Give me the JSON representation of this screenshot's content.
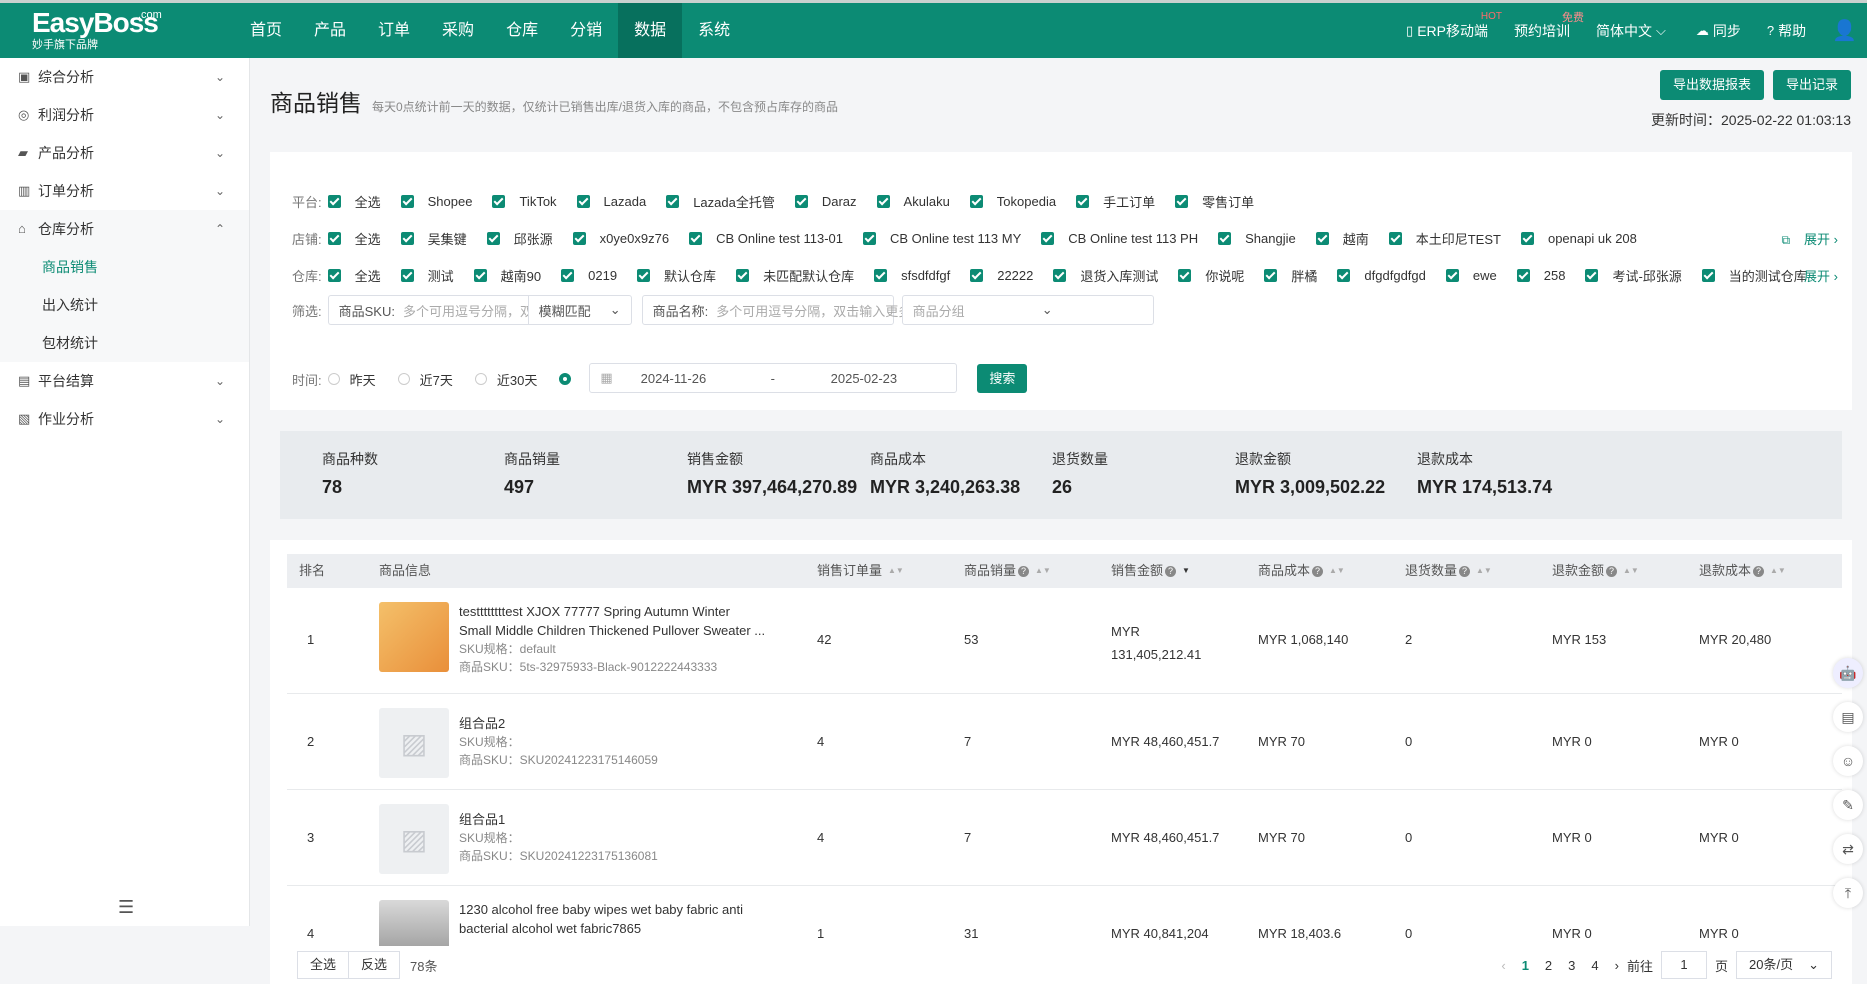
{
  "brand": {
    "logo": "EasyBoss",
    "com": ".com",
    "sub": "妙手旗下品牌"
  },
  "nav": [
    "首页",
    "产品",
    "订单",
    "采购",
    "仓库",
    "分销",
    "数据",
    "系统"
  ],
  "right_nav": {
    "erp": "ERP移动端",
    "hot": "HOT",
    "train": "预约培训",
    "free": "免费",
    "lang": "简体中文",
    "sync": "同步",
    "help": "帮助"
  },
  "sidebar": {
    "groups": [
      "综合分析",
      "利润分析",
      "产品分析",
      "订单分析",
      "仓库分析",
      "平台结算",
      "作业分析"
    ],
    "sub": [
      "商品销售",
      "出入统计",
      "包材统计"
    ]
  },
  "page": {
    "title": "商品销售",
    "desc": "每天0点统计前一天的数据，仅统计已销售出库/退货入库的商品，不包含预占库存的商品",
    "export_report": "导出数据报表",
    "export_log": "导出记录",
    "update_label": "更新时间：",
    "update_time": "2025-02-22 01:03:13"
  },
  "filters": {
    "platform_label": "平台:",
    "platforms": [
      "全选",
      "Shopee",
      "TikTok",
      "Lazada",
      "Lazada全托管",
      "Daraz",
      "Akulaku",
      "Tokopedia",
      "手工订单",
      "零售订单"
    ],
    "shop_label": "店铺:",
    "shops": [
      "全选",
      "吴集键",
      "邱张源",
      "x0ye0x9z76",
      "CB Online test 113-01",
      "CB Online test 113 MY",
      "CB Online test 113 PH",
      "Shangjie",
      "越南",
      "本土印尼TEST",
      "openapi uk 208"
    ],
    "warehouse_label": "仓库:",
    "warehouses": [
      "全选",
      "测试",
      "越南90",
      "0219",
      "默认仓库",
      "未匹配默认仓库",
      "sfsdfdfgf",
      "22222",
      "退货入库测试",
      "你说呢",
      "胖橘",
      "dfgdfgdfgd",
      "ewe",
      "258",
      "考试-邱张源",
      "当的测试仓库"
    ],
    "expand": "展开",
    "filter_label": "筛选:",
    "sku_label": "商品SKU:",
    "sku_placeholder": "多个可用逗号分隔，双击",
    "match": "模糊匹配",
    "name_label": "商品名称:",
    "name_placeholder": "多个可用逗号分隔，双击输入更多",
    "group_placeholder": "商品分组",
    "time_label": "时间:",
    "times": [
      "昨天",
      "近7天",
      "近30天"
    ],
    "date_start": "2024-11-26",
    "date_sep": "-",
    "date_end": "2025-02-23",
    "search": "搜索"
  },
  "stats": [
    {
      "label": "商品种数",
      "value": "78"
    },
    {
      "label": "商品销量",
      "value": "497"
    },
    {
      "label": "销售金额",
      "value": "MYR 397,464,270.89"
    },
    {
      "label": "商品成本",
      "value": "MYR 3,240,263.38"
    },
    {
      "label": "退货数量",
      "value": "26"
    },
    {
      "label": "退款金额",
      "value": "MYR 3,009,502.22"
    },
    {
      "label": "退款成本",
      "value": "MYR 174,513.74"
    }
  ],
  "table": {
    "headers": [
      "排名",
      "商品信息",
      "销售订单量",
      "商品销量",
      "销售金额",
      "商品成本",
      "退货数量",
      "退款金额",
      "退款成本"
    ],
    "rows": [
      {
        "rank": "1",
        "name1": "testtttttttest XJOX 77777 Spring Autumn Winter",
        "name2": "Small Middle Children Thickened Pullover Sweater ...",
        "spec": "SKU规格：default",
        "sku": "商品SKU：5ts-32975933-Black-9012222443333",
        "orders": "42",
        "qty": "53",
        "amount1": "MYR",
        "amount2": "131,405,212.41",
        "cost": "MYR 1,068,140",
        "ret": "2",
        "refund": "MYR 153",
        "refund_cost": "MYR 20,480"
      },
      {
        "rank": "2",
        "name1": "组合品2",
        "spec": "SKU规格：",
        "sku": "商品SKU：SKU20241223175146059",
        "orders": "4",
        "qty": "7",
        "amount": "MYR 48,460,451.7",
        "cost": "MYR 70",
        "ret": "0",
        "refund": "MYR 0",
        "refund_cost": "MYR 0"
      },
      {
        "rank": "3",
        "name1": "组合品1",
        "spec": "SKU规格：",
        "sku": "商品SKU：SKU20241223175136081",
        "orders": "4",
        "qty": "7",
        "amount": "MYR 48,460,451.7",
        "cost": "MYR 70",
        "ret": "0",
        "refund": "MYR 0",
        "refund_cost": "MYR 0"
      },
      {
        "rank": "4",
        "name1": "1230 alcohol free baby wipes wet baby fabric anti",
        "name2": "bacterial alcohol wet fabric7865",
        "orders": "1",
        "qty": "31",
        "amount": "MYR 40,841,204",
        "cost": "MYR 18,403.6",
        "ret": "0",
        "refund": "MYR 0",
        "refund_cost": "MYR 0"
      }
    ]
  },
  "footer": {
    "select_all": "全选",
    "invert": "反选",
    "count": "78条",
    "pages": [
      "1",
      "2",
      "3",
      "4"
    ],
    "goto": "前往",
    "goto_val": "1",
    "page_unit": "页",
    "page_size": "20条/页"
  }
}
